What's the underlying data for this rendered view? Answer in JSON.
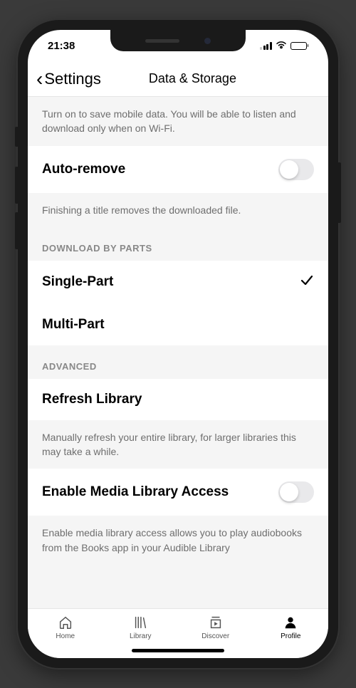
{
  "status": {
    "time": "21:38"
  },
  "nav": {
    "back_label": "Settings",
    "title": "Data & Storage"
  },
  "stream_desc": "Turn on to save mobile data. You will be able to listen and download only when on Wi-Fi.",
  "auto_remove": {
    "label": "Auto-remove",
    "desc": "Finishing a title removes the downloaded file."
  },
  "download_parts": {
    "header": "Download by Parts",
    "single": "Single-Part",
    "multi": "Multi-Part"
  },
  "advanced": {
    "header": "Advanced",
    "refresh_label": "Refresh Library",
    "refresh_desc": "Manually refresh your entire library, for larger libraries this may take a while.",
    "media_access_label": "Enable Media Library Access",
    "media_access_desc": "Enable media library access allows you to play audiobooks from the Books app in your Audible Library"
  },
  "tabs": {
    "home": "Home",
    "library": "Library",
    "discover": "Discover",
    "profile": "Profile"
  }
}
